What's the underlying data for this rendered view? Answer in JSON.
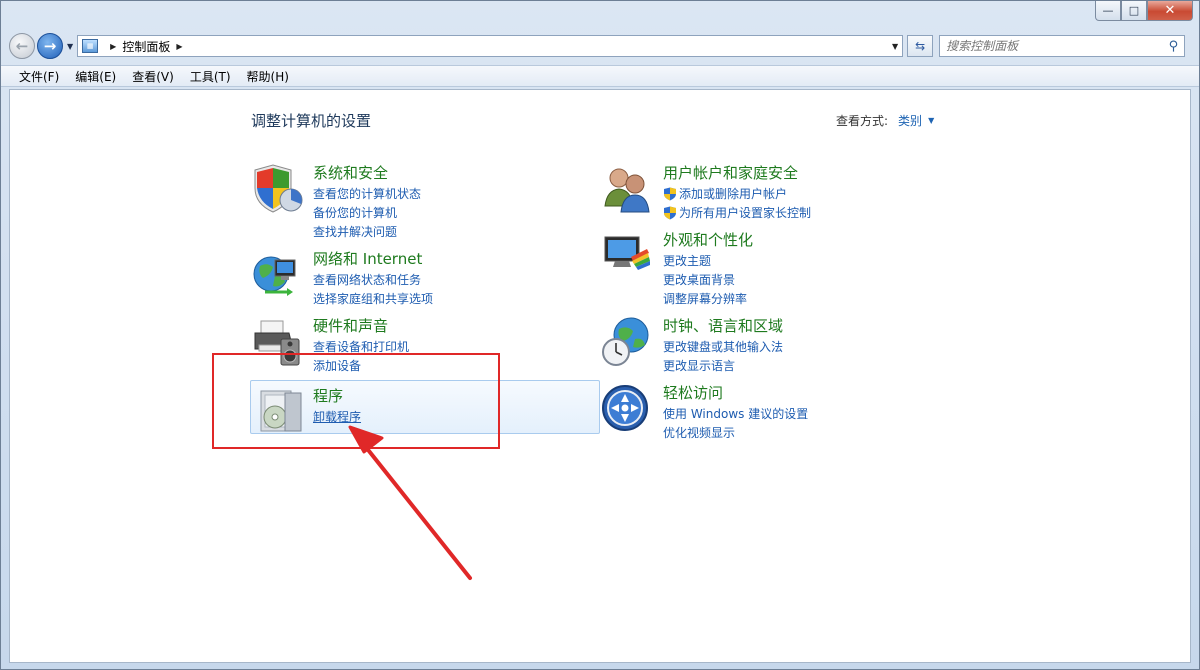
{
  "address": {
    "path": "控制面板",
    "search_placeholder": "搜索控制面板"
  },
  "menu": [
    "文件(F)",
    "编辑(E)",
    "查看(V)",
    "工具(T)",
    "帮助(H)"
  ],
  "page": {
    "title": "调整计算机的设置",
    "view_by_label": "查看方式:",
    "view_by_value": "类别"
  },
  "categories": {
    "system": {
      "title": "系统和安全",
      "links": [
        "查看您的计算机状态",
        "备份您的计算机",
        "查找并解决问题"
      ]
    },
    "network": {
      "title": "网络和 Internet",
      "links": [
        "查看网络状态和任务",
        "选择家庭组和共享选项"
      ]
    },
    "hardware": {
      "title": "硬件和声音",
      "links": [
        "查看设备和打印机",
        "添加设备"
      ]
    },
    "programs": {
      "title": "程序",
      "links": [
        "卸载程序"
      ]
    },
    "users": {
      "title": "用户帐户和家庭安全",
      "links": [
        "添加或删除用户帐户",
        "为所有用户设置家长控制"
      ]
    },
    "appearance": {
      "title": "外观和个性化",
      "links": [
        "更改主题",
        "更改桌面背景",
        "调整屏幕分辨率"
      ]
    },
    "clock": {
      "title": "时钟、语言和区域",
      "links": [
        "更改键盘或其他输入法",
        "更改显示语言"
      ]
    },
    "ease": {
      "title": "轻松访问",
      "links": [
        "使用 Windows 建议的设置",
        "优化视频显示"
      ]
    }
  },
  "colors": {
    "category_title": "#1e7a1e",
    "link": "#1e5cb0",
    "highlight": "#e02828"
  }
}
